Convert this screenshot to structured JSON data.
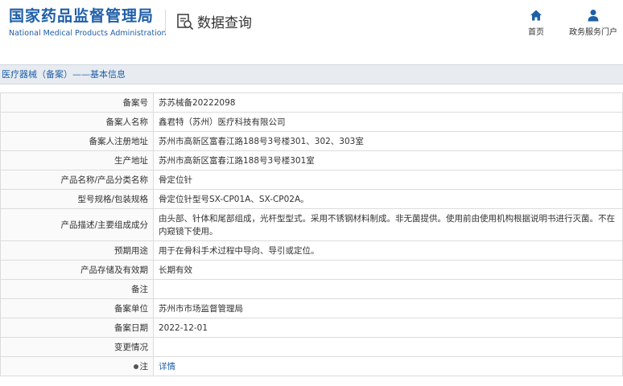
{
  "header": {
    "logo_cn": "国家药品监督管理局",
    "logo_en": "National Medical Products Administration",
    "query_title": "数据查询",
    "nav": {
      "home_label": "首页",
      "gov_label": "政务服务门户"
    }
  },
  "breadcrumb": "医疗器械（备案）——基本信息",
  "rows": [
    {
      "label": "备案号",
      "value": "苏苏械备20222098"
    },
    {
      "label": "备案人名称",
      "value": "鑫君特（苏州）医疗科技有限公司"
    },
    {
      "label": "备案人注册地址",
      "value": "苏州市高新区富春江路188号3号楼301、302、303室"
    },
    {
      "label": "生产地址",
      "value": "苏州市高新区富春江路188号3号楼301室"
    },
    {
      "label": "产品名称/产品分类名称",
      "value": "骨定位针"
    },
    {
      "label": "型号规格/包装规格",
      "value": "骨定位针型号SX-CP01A、SX-CP02A。"
    },
    {
      "label": "产品描述/主要组成成分",
      "value": "由头部、针体和尾部组成，光杆型型式。采用不锈钢材料制成。非无菌提供。使用前由使用机构根据说明书进行灭菌。不在内窥镜下使用。"
    },
    {
      "label": "预期用途",
      "value": "用于在骨科手术过程中导向、导引或定位。"
    },
    {
      "label": "产品存储及有效期",
      "value": "长期有效"
    },
    {
      "label": "备注",
      "value": ""
    },
    {
      "label": "备案单位",
      "value": "苏州市市场监督管理局"
    },
    {
      "label": "备案日期",
      "value": "2022-12-01"
    },
    {
      "label": "变更情况",
      "value": ""
    }
  ],
  "footnote": {
    "label": "注",
    "link": "详情"
  },
  "colors": {
    "brand_blue": "#1f5fa8",
    "subhead_bg": "#e8ecf1"
  }
}
